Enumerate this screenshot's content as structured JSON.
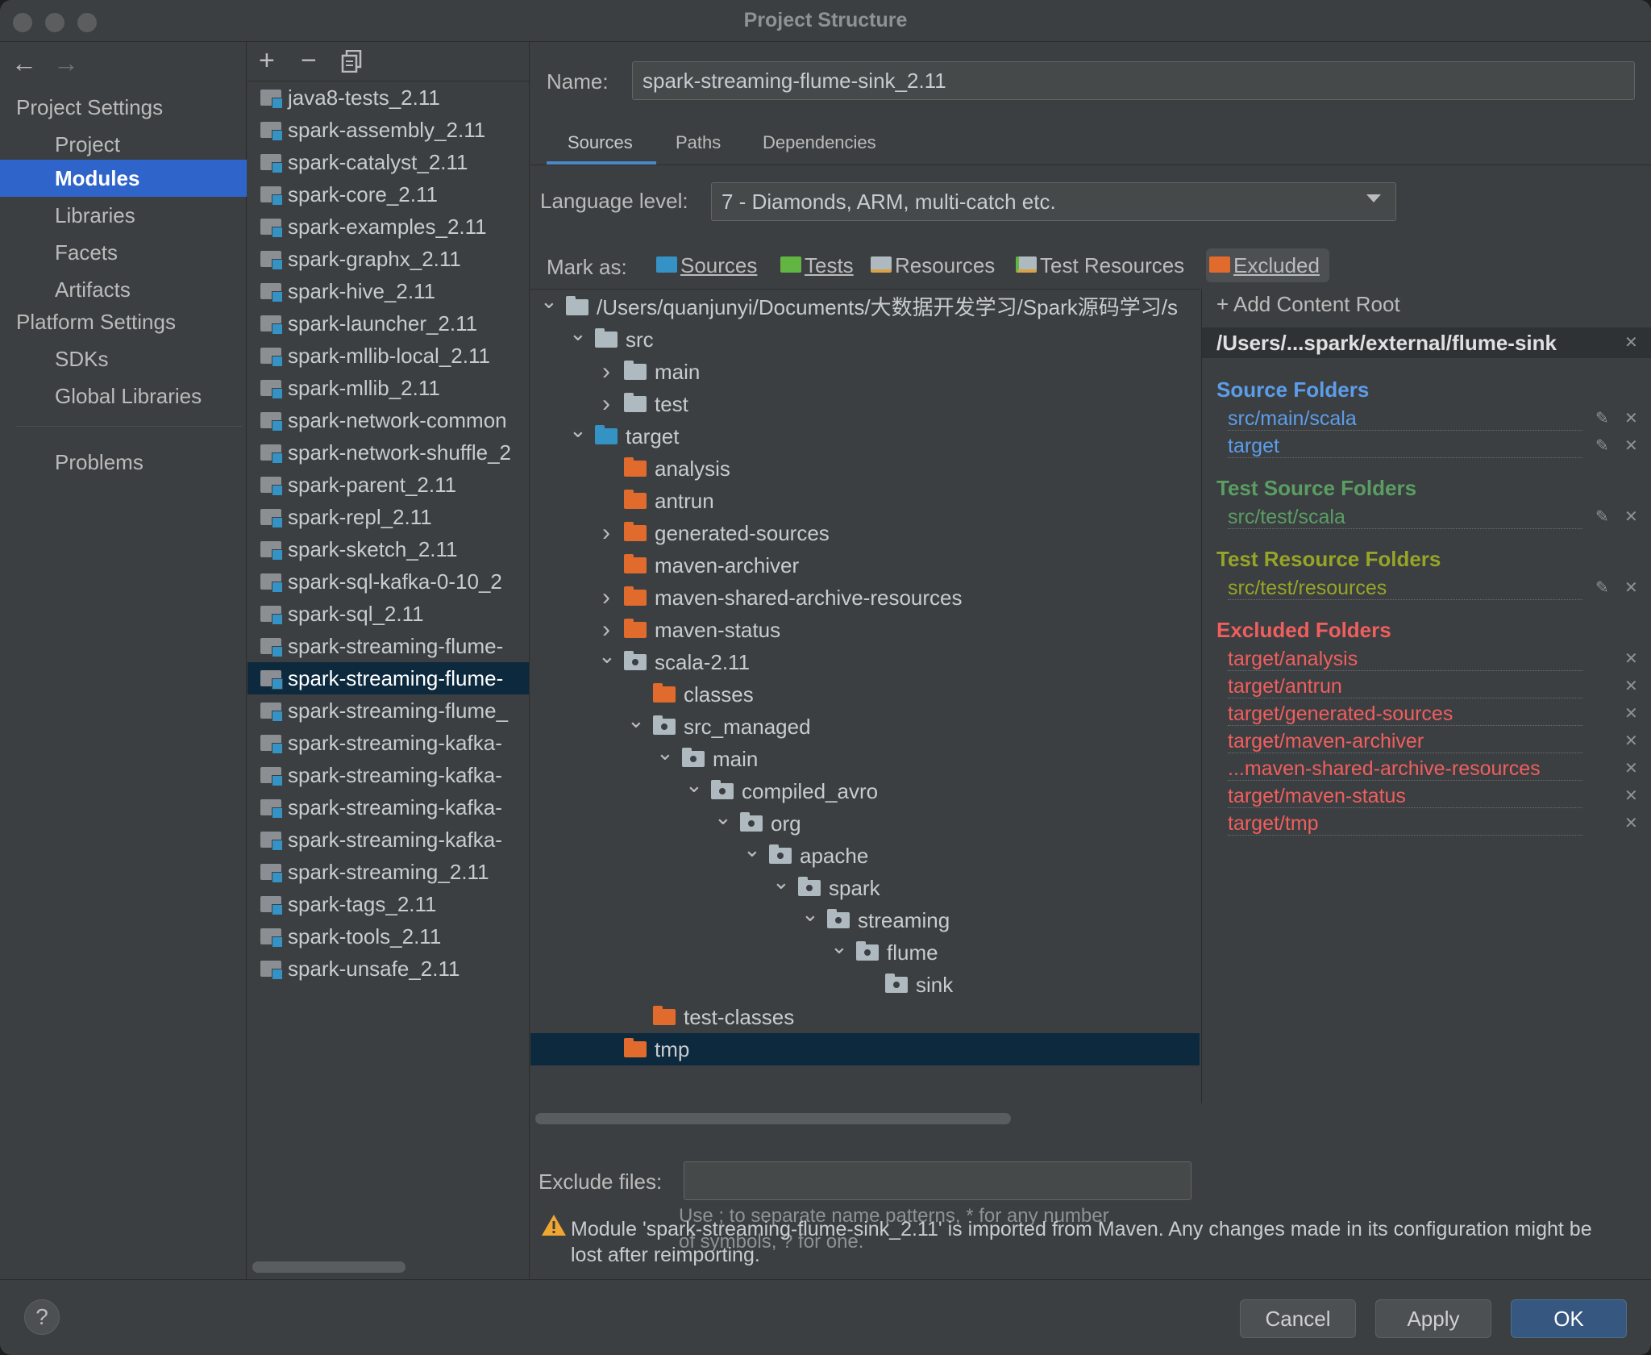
{
  "window": {
    "title": "Project Structure"
  },
  "nav": {
    "back_icon": "arrow-left-icon",
    "forward_icon": "arrow-right-icon",
    "project_settings": "Project Settings",
    "platform_settings": "Platform Settings",
    "items": [
      {
        "label": "Project"
      },
      {
        "label": "Modules"
      },
      {
        "label": "Libraries"
      },
      {
        "label": "Facets"
      },
      {
        "label": "Artifacts"
      },
      {
        "label": "SDKs"
      },
      {
        "label": "Global Libraries"
      },
      {
        "label": "Problems"
      }
    ],
    "selected": "Modules"
  },
  "module_toolbar": {
    "add": "+",
    "remove": "−",
    "copy_icon": "copy-icon"
  },
  "modules": [
    "java8-tests_2.11",
    "spark-assembly_2.11",
    "spark-catalyst_2.11",
    "spark-core_2.11",
    "spark-examples_2.11",
    "spark-graphx_2.11",
    "spark-hive_2.11",
    "spark-launcher_2.11",
    "spark-mllib-local_2.11",
    "spark-mllib_2.11",
    "spark-network-common",
    "spark-network-shuffle_2",
    "spark-parent_2.11",
    "spark-repl_2.11",
    "spark-sketch_2.11",
    "spark-sql-kafka-0-10_2",
    "spark-sql_2.11",
    "spark-streaming-flume-",
    "spark-streaming-flume-",
    "spark-streaming-flume_",
    "spark-streaming-kafka-",
    "spark-streaming-kafka-",
    "spark-streaming-kafka-",
    "spark-streaming-kafka-",
    "spark-streaming_2.11",
    "spark-tags_2.11",
    "spark-tools_2.11",
    "spark-unsafe_2.11"
  ],
  "main": {
    "name_label": "Name:",
    "name_value": "spark-streaming-flume-sink_2.11",
    "tabs": [
      {
        "label": "Sources"
      },
      {
        "label": "Paths"
      },
      {
        "label": "Dependencies"
      }
    ],
    "language_label": "Language level:",
    "language_value": "7 - Diamonds, ARM, multi-catch etc.",
    "mark_as_label": "Mark as:",
    "mark_as": [
      {
        "label": "Sources",
        "color": "#3592c4"
      },
      {
        "label": "Tests",
        "color": "#62b543"
      },
      {
        "label": "Resources",
        "color": "#aeb9c0"
      },
      {
        "label": "Test Resources",
        "color": "#aeb9c0"
      },
      {
        "label": "Excluded",
        "color": "#e16b2c"
      }
    ],
    "tree": [
      {
        "name": "/Users/quanjunyi/Documents/大数据开发学习/Spark源码学习/s",
        "type": "grey",
        "expand": "open"
      },
      {
        "name": "src",
        "type": "grey",
        "expand": "open"
      },
      {
        "name": "main",
        "type": "grey",
        "expand": "closed"
      },
      {
        "name": "test",
        "type": "grey",
        "expand": "closed"
      },
      {
        "name": "target",
        "type": "blue",
        "expand": "open"
      },
      {
        "name": "analysis",
        "type": "orange",
        "expand": ""
      },
      {
        "name": "antrun",
        "type": "orange",
        "expand": ""
      },
      {
        "name": "generated-sources",
        "type": "orange",
        "expand": "closed"
      },
      {
        "name": "maven-archiver",
        "type": "orange",
        "expand": ""
      },
      {
        "name": "maven-shared-archive-resources",
        "type": "orange",
        "expand": "closed"
      },
      {
        "name": "maven-status",
        "type": "orange",
        "expand": "closed"
      },
      {
        "name": "scala-2.11",
        "type": "pkg",
        "expand": "open"
      },
      {
        "name": "classes",
        "type": "orange",
        "expand": ""
      },
      {
        "name": "src_managed",
        "type": "pkg",
        "expand": "open"
      },
      {
        "name": "main",
        "type": "pkg",
        "expand": "open"
      },
      {
        "name": "compiled_avro",
        "type": "pkg",
        "expand": "open"
      },
      {
        "name": "org",
        "type": "pkg",
        "expand": "open"
      },
      {
        "name": "apache",
        "type": "pkg",
        "expand": "open"
      },
      {
        "name": "spark",
        "type": "pkg",
        "expand": "open"
      },
      {
        "name": "streaming",
        "type": "pkg",
        "expand": "open"
      },
      {
        "name": "flume",
        "type": "pkg",
        "expand": "open"
      },
      {
        "name": "sink",
        "type": "pkg",
        "expand": ""
      },
      {
        "name": "test-classes",
        "type": "orange",
        "expand": ""
      },
      {
        "name": "tmp",
        "type": "orange",
        "expand": ""
      }
    ],
    "exclude_label": "Exclude files:",
    "exclude_value": "",
    "hint_line1": "Use ; to separate name patterns, * for any number",
    "hint_line2": "of symbols, ? for one.",
    "warning_icon": "warning-icon",
    "warning": "Module 'spark-streaming-flume-sink_2.11' is imported from Maven. Any changes made in its configuration might be lost after reimporting."
  },
  "roots": {
    "add_content_root": "Add Content Root",
    "root_path": "/Users/...spark/external/flume-sink",
    "groups": [
      {
        "title": "Source Folders",
        "color": "#5c9dea",
        "items": [
          "src/main/scala",
          "target"
        ],
        "editable": true
      },
      {
        "title": "Test Source Folders",
        "color": "#5a9e63",
        "items": [
          "src/test/scala"
        ],
        "editable": true
      },
      {
        "title": "Test Resource Folders",
        "color": "#97a526",
        "items": [
          "src/test/resources"
        ],
        "editable": true
      },
      {
        "title": "Excluded Folders",
        "color": "#f05e5e",
        "items": [
          "target/analysis",
          "target/antrun",
          "target/generated-sources",
          "target/maven-archiver",
          "...maven-shared-archive-resources",
          "target/maven-status",
          "target/tmp"
        ],
        "editable": false
      }
    ]
  },
  "footer": {
    "help": "?",
    "cancel": "Cancel",
    "apply": "Apply",
    "ok": "OK"
  },
  "colors": {
    "selection": "#2f65ca",
    "tree_selection": "#0d293e",
    "primary_button": "#365880"
  }
}
